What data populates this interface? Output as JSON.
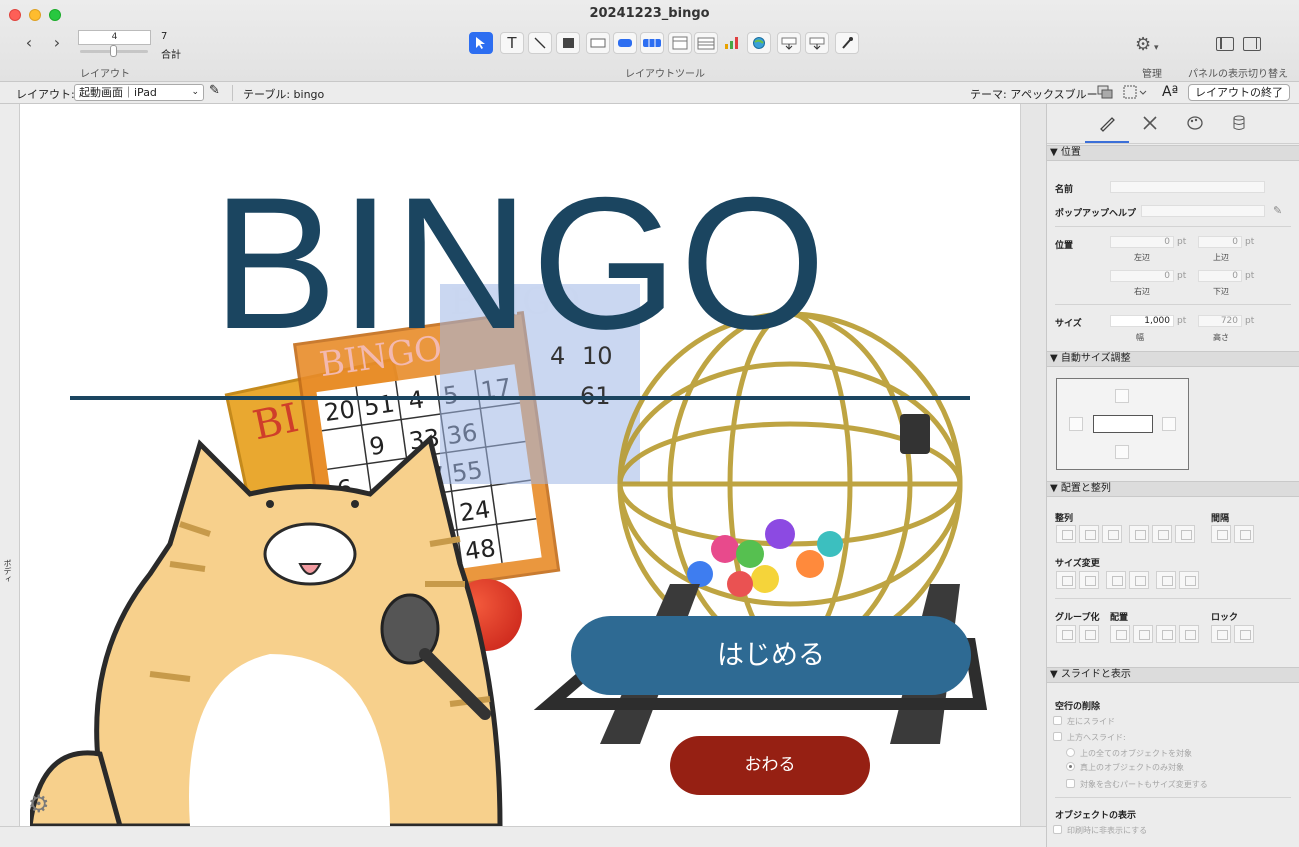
{
  "window": {
    "title": "20241223_bingo"
  },
  "toolbar": {
    "layout_number": "4",
    "layout_total": "7",
    "total_label": "合計",
    "layout_caption": "レイアウト",
    "tools_caption": "レイアウトツール",
    "manage_caption": "管理",
    "panel_caption": "パネルの表示切り替え",
    "tools": [
      "select-arrow-icon",
      "text-tool-icon",
      "line-tool-icon",
      "shape-tool-icon",
      "field-tool-icon",
      "button-tool-icon",
      "button-bar-tool-icon",
      "portal-tool-icon",
      "tab-tool-icon",
      "chart-tool-icon",
      "web-viewer-icon",
      "field-picker-icon",
      "part-tool-icon",
      "format-painter-icon"
    ]
  },
  "layoutbar": {
    "layout_label": "レイアウト:",
    "layout_value": "起動画面｜iPad",
    "table_label": "テーブル: bingo",
    "theme_label": "テーマ: アペックスブルー",
    "exit_button": "レイアウトの終了"
  },
  "canvas": {
    "body_label": "ボディ",
    "title": "BINGO",
    "start_button": "はじめる",
    "end_button": "おわる"
  },
  "colors": {
    "title_blue": "#1b4560",
    "start_blue": "#2e6a93",
    "end_red": "#962013",
    "accent": "#2d6ef1"
  },
  "inspector": {
    "tabs": [
      "position-tab-icon",
      "styles-tab-icon",
      "appearance-tab-icon",
      "data-tab-icon"
    ],
    "position_section": "▼ 位置",
    "name_label": "名前",
    "popup_help_label": "ポップアップヘルプ",
    "position_label": "位置",
    "left_value": "0",
    "left_label": "左辺",
    "top_value": "0",
    "top_label": "上辺",
    "right_value": "0",
    "right_label": "右辺",
    "bottom_value": "0",
    "bottom_label": "下辺",
    "unit": "pt",
    "size_label": "サイズ",
    "width_value": "1,000",
    "width_label": "幅",
    "height_value": "720",
    "height_label": "高さ",
    "autosize_section": "▼ 自動サイズ調整",
    "arrange_section": "▼ 配置と整列",
    "align_label": "整列",
    "spacing_label": "間隔",
    "resize_label": "サイズ変更",
    "group_label": "グループ化",
    "arrange_label": "配置",
    "lock_label": "ロック",
    "sliding_section": "▼ スライドと表示",
    "remove_space_label": "空行の削除",
    "slide_left": "左にスライド",
    "slide_up": "上方へスライド:",
    "all_above": "上の全てのオブジェクトを対象",
    "directly_above": "真上のオブジェクトのみ対象",
    "resize_part": "対象を含むパートもサイズ変更する",
    "object_display_label": "オブジェクトの表示",
    "hide_when_printing": "印刷時に非表示にする"
  }
}
